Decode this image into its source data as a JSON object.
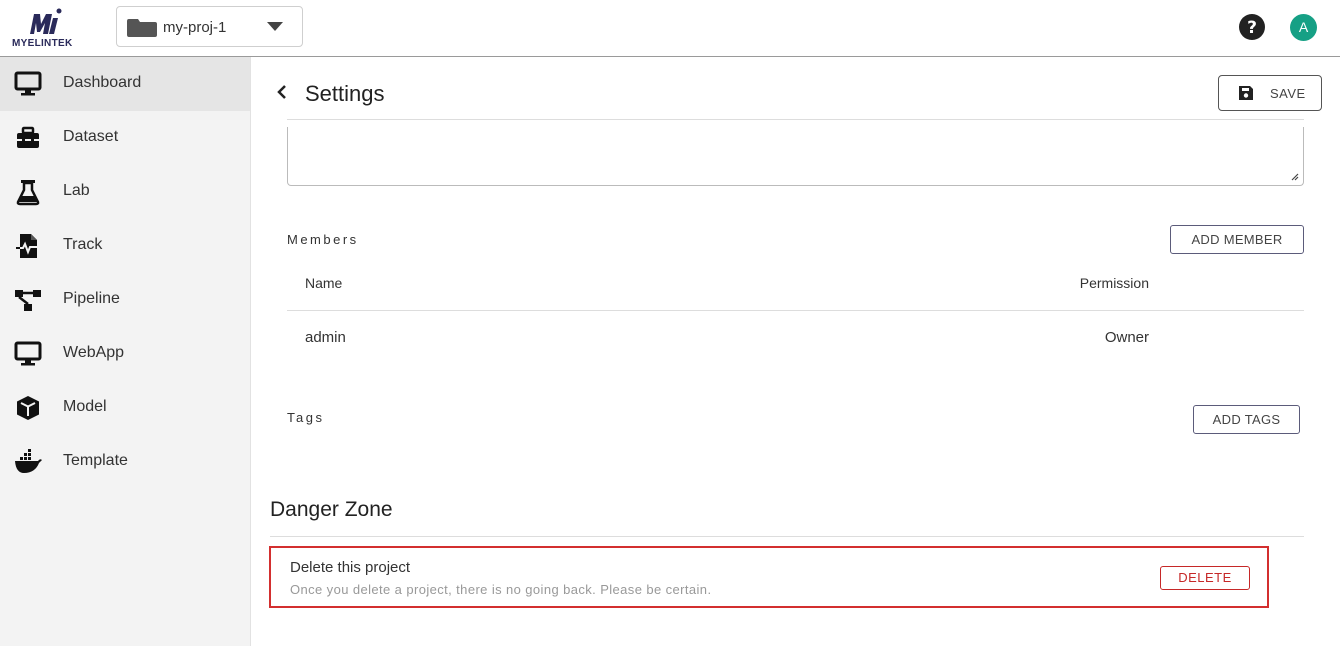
{
  "brand": {
    "name": "MyelinTek"
  },
  "project_selector": {
    "value": "my-proj-1"
  },
  "user": {
    "avatar_initial": "A"
  },
  "colors": {
    "avatar_bg": "#16a085",
    "danger": "#d32f2f",
    "sidebar_bg": "#f3f3f3",
    "active_item_bg": "#e5e5e5"
  },
  "sidebar": {
    "items": [
      {
        "label": "Dashboard",
        "icon": "monitor-icon",
        "active": true
      },
      {
        "label": "Dataset",
        "icon": "toolbox-icon"
      },
      {
        "label": "Lab",
        "icon": "flask-icon"
      },
      {
        "label": "Track",
        "icon": "file-waveform-icon"
      },
      {
        "label": "Pipeline",
        "icon": "pipeline-icon"
      },
      {
        "label": "WebApp",
        "icon": "monitor-icon"
      },
      {
        "label": "Model",
        "icon": "cube-icon"
      },
      {
        "label": "Template",
        "icon": "docker-icon"
      }
    ]
  },
  "header": {
    "title": "Settings",
    "save_label": "SAVE"
  },
  "members": {
    "label": "Members",
    "add_label": "ADD MEMBER",
    "columns": {
      "name": "Name",
      "permission": "Permission"
    },
    "rows": [
      {
        "name": "admin",
        "permission": "Owner"
      }
    ]
  },
  "tags": {
    "label": "Tags",
    "add_label": "ADD TAGS"
  },
  "danger_zone": {
    "title": "Danger Zone",
    "item_title": "Delete this project",
    "item_desc": "Once you delete a project, there is no going back. Please be certain.",
    "delete_label": "DELETE"
  }
}
